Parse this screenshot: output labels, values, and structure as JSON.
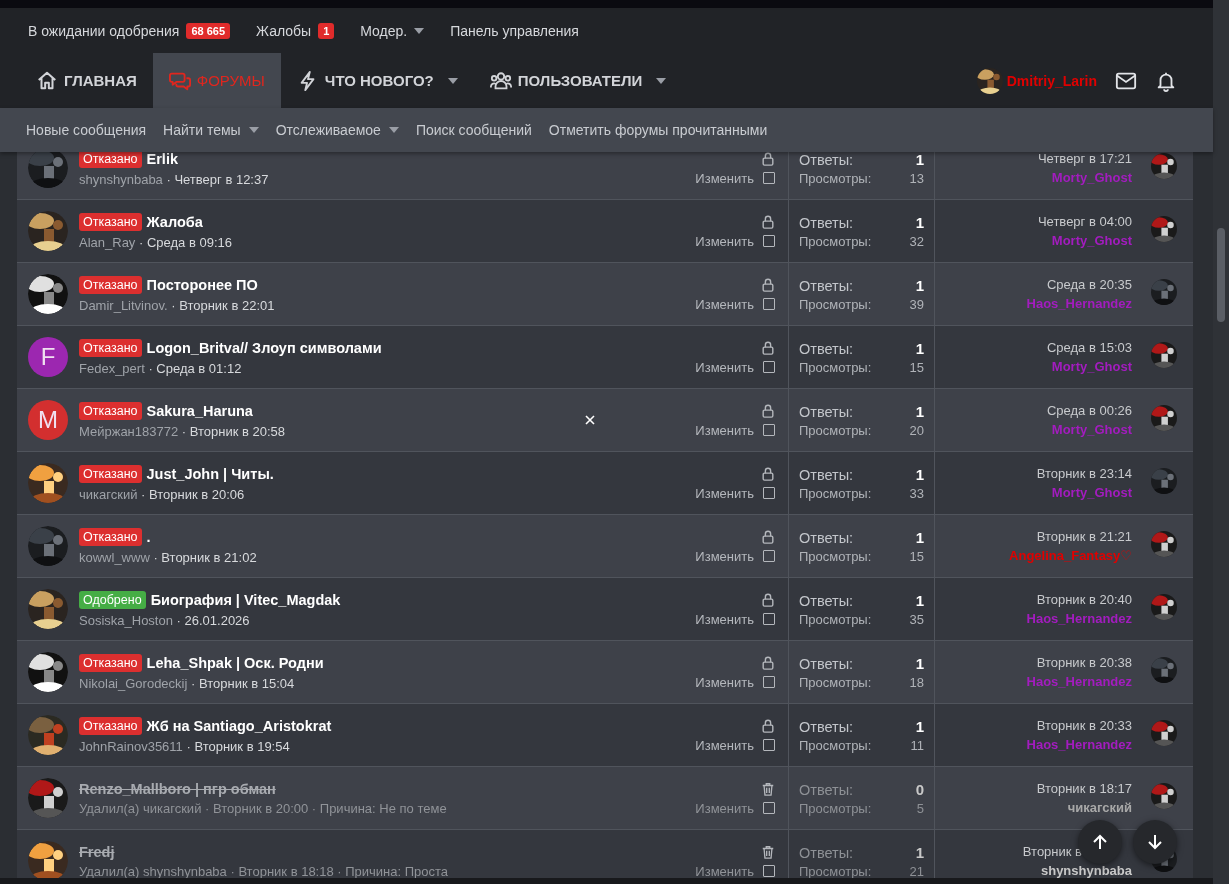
{
  "top_links": [
    {
      "label": "В ожидании одобрения",
      "badge": "68 665",
      "has_menu": false
    },
    {
      "label": "Жалобы",
      "badge": "1",
      "has_menu": false
    },
    {
      "label": "Модер.",
      "has_menu": true
    },
    {
      "label": "Панель управления",
      "has_menu": false
    }
  ],
  "nav_tabs": [
    {
      "label": "ГЛАВНАЯ",
      "selected": false,
      "has_menu": false
    },
    {
      "label": "ФОРУМЫ",
      "selected": true,
      "has_menu": false
    },
    {
      "label": "ЧТО НОВОГО?",
      "selected": false,
      "has_menu": true
    },
    {
      "label": "ПОЛЬЗОВАТЕЛИ",
      "selected": false,
      "has_menu": true
    }
  ],
  "user": {
    "name": "Dmitriy_Larin"
  },
  "sub_nav": [
    {
      "label": "Новые сообщения",
      "has_menu": false
    },
    {
      "label": "Найти темы",
      "has_menu": true
    },
    {
      "label": "Отслеживаемое",
      "has_menu": true
    },
    {
      "label": "Поиск сообщений",
      "has_menu": false
    },
    {
      "label": "Отметить форумы прочитанными",
      "has_menu": false
    }
  ],
  "threads": [
    {
      "label": {
        "text": "Отказано",
        "kind": "rejected"
      },
      "title": "Erlik",
      "deleted": false,
      "meta": "shynshynbaba **· Четверг в 12:37**",
      "hovered": false,
      "edit": "Изменить",
      "checked": false,
      "replies_label": "Ответы:",
      "replies": "1",
      "views_label": "Просмотры:",
      "views": "13",
      "last_post": {
        "date": "Четверг в 17:21",
        "user": "Morty_Ghost",
        "color": "#a31cbf"
      }
    },
    {
      "label": {
        "text": "Отказано",
        "kind": "rejected"
      },
      "title": "Жалоба",
      "deleted": false,
      "meta": "Alan_Ray **· Среда в 09:16**",
      "hovered": false,
      "edit": "Изменить",
      "checked": false,
      "replies_label": "Ответы:",
      "replies": "1",
      "views_label": "Просмотры:",
      "views": "32",
      "last_post": {
        "date": "Четверг в 04:00",
        "user": "Morty_Ghost",
        "color": "#a31cbf"
      }
    },
    {
      "label": {
        "text": "Отказано",
        "kind": "rejected"
      },
      "title": "Посторонее ПО",
      "deleted": false,
      "meta": "Damir_Litvinov. **· Вторник в 22:01**",
      "hovered": false,
      "edit": "Изменить",
      "checked": false,
      "replies_label": "Ответы:",
      "replies": "1",
      "views_label": "Просмотры:",
      "views": "39",
      "last_post": {
        "date": "Среда в 20:35",
        "user": "Haos_Hernandez",
        "color": "#a31cbf"
      }
    },
    {
      "avatar": {
        "kind": "letter",
        "letter": "F",
        "color": "#9c27b0"
      },
      "label": {
        "text": "Отказано",
        "kind": "rejected"
      },
      "title": "Logon_Britva// Злоуп символами",
      "deleted": false,
      "meta": "Fedex_pert **· Среда в 01:12**",
      "hovered": false,
      "edit": "Изменить",
      "checked": false,
      "replies_label": "Ответы:",
      "replies": "1",
      "views_label": "Просмотры:",
      "views": "15",
      "last_post": {
        "date": "Среда в 15:03",
        "user": "Morty_Ghost",
        "color": "#a31cbf"
      }
    },
    {
      "avatar": {
        "kind": "letter",
        "letter": "M",
        "color": "#d32f2f"
      },
      "label": {
        "text": "Отказано",
        "kind": "rejected"
      },
      "title": "Sakura_Haruna",
      "deleted": false,
      "meta": "Мейржан183772 **· Вторник в 20:58**",
      "hovered": true,
      "edit": "Изменить",
      "checked": false,
      "replies_label": "Ответы:",
      "replies": "1",
      "views_label": "Просмотры:",
      "views": "20",
      "last_post": {
        "date": "Среда в 00:26",
        "user": "Morty_Ghost",
        "color": "#a31cbf"
      }
    },
    {
      "label": {
        "text": "Отказано",
        "kind": "rejected"
      },
      "title": "Just_John | Читы.",
      "deleted": false,
      "meta": "чикагский **· Вторник в 20:06**",
      "hovered": false,
      "edit": "Изменить",
      "checked": false,
      "replies_label": "Ответы:",
      "replies": "1",
      "views_label": "Просмотры:",
      "views": "33",
      "last_post": {
        "date": "Вторник в 23:14",
        "user": "Morty_Ghost",
        "color": "#a31cbf"
      }
    },
    {
      "label": {
        "text": "Отказано",
        "kind": "rejected"
      },
      "title": ".",
      "deleted": false,
      "meta": "kowwl_www **· Вторник в 21:02**",
      "hovered": false,
      "edit": "Изменить",
      "checked": false,
      "replies_label": "Ответы:",
      "replies": "1",
      "views_label": "Просмотры:",
      "views": "15",
      "last_post": {
        "date": "Вторник в 21:21",
        "user": "Angelina_Fantasy♡",
        "color": "#e00000"
      }
    },
    {
      "label": {
        "text": "Одобрено",
        "kind": "approved"
      },
      "title": "Биография | Vitec_Magdak",
      "deleted": false,
      "meta": "Sosiska_Hoston **· 26.01.2026**",
      "hovered": false,
      "edit": "Изменить",
      "checked": false,
      "replies_label": "Ответы:",
      "replies": "1",
      "views_label": "Просмотры:",
      "views": "35",
      "last_post": {
        "date": "Вторник в 20:40",
        "user": "Haos_Hernandez",
        "color": "#a31cbf"
      }
    },
    {
      "label": {
        "text": "Отказано",
        "kind": "rejected"
      },
      "title": "Leha_Shpak | Оск. Родни",
      "deleted": false,
      "meta": "Nikolai_Gorodeckij **· Вторник в 15:04**",
      "hovered": false,
      "edit": "Изменить",
      "checked": false,
      "replies_label": "Ответы:",
      "replies": "1",
      "views_label": "Просмотры:",
      "views": "18",
      "last_post": {
        "date": "Вторник в 20:38",
        "user": "Haos_Hernandez",
        "color": "#a31cbf"
      }
    },
    {
      "label": {
        "text": "Отказано",
        "kind": "rejected"
      },
      "title": "Жб на Santiago_Aristokrat",
      "deleted": false,
      "meta": "JohnRainov35611 **· Вторник в 19:54**",
      "hovered": false,
      "edit": "Изменить",
      "checked": false,
      "replies_label": "Ответы:",
      "replies": "1",
      "views_label": "Просмотры:",
      "views": "11",
      "last_post": {
        "date": "Вторник в 20:33",
        "user": "Haos_Hernandez",
        "color": "#a31cbf"
      }
    },
    {
      "title": "Renzo_Mallboro | пгр обман",
      "deleted": true,
      "meta": "Удалил(а) чикагский · Вторник в 20:00 · Причина: Не по теме",
      "hovered": false,
      "edit": "Изменить",
      "checked": false,
      "replies_label": "Ответы:",
      "replies": "0",
      "views_label": "Просмотры:",
      "views": "5",
      "last_post": {
        "date": "Вторник в 18:17",
        "user": "чикагский",
        "color": "#a8a8a8"
      }
    },
    {
      "title": "Fredj",
      "deleted": true,
      "meta": "Удалил(а) shynshynbaba · Вторник в 18:18 · Причина: Проста",
      "hovered": false,
      "edit": "Изменить",
      "checked": false,
      "replies_label": "Ответы:",
      "replies": "1",
      "views_label": "Просмотры:",
      "views": "21",
      "last_post": {
        "date": "Вторник в",
        "user": "shynshynbaba",
        "color": "#c8c8c8"
      }
    }
  ]
}
